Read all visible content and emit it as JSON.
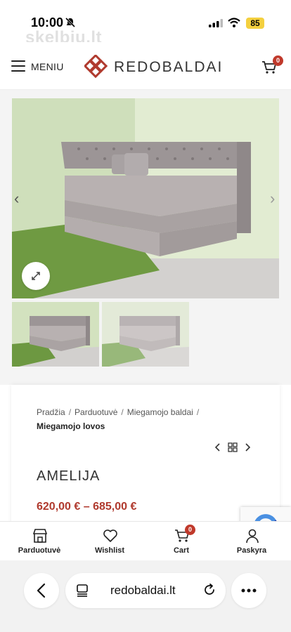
{
  "status_bar": {
    "time": "10:00",
    "battery": "85",
    "watermark": "skelbiu.lt"
  },
  "header": {
    "menu_label": "MENIU",
    "logo_text": "REDOBALDAI",
    "cart_count": "0"
  },
  "gallery": {
    "prev_arrow": "‹",
    "next_arrow": "›"
  },
  "breadcrumb": {
    "items": [
      "Pradžia",
      "Parduotuvė",
      "Miegamojo baldai"
    ],
    "separator": "/",
    "current": "Miegamojo lovos"
  },
  "product": {
    "title": "AMELIJA",
    "price": "620,00 € – 685,00 €"
  },
  "bottom_nav": {
    "shop": "Parduotuvė",
    "wishlist": "Wishlist",
    "cart": "Cart",
    "cart_count": "0",
    "account": "Paskyra"
  },
  "browser": {
    "url": "redobaldai.lt"
  },
  "colors": {
    "accent": "#b03a2e",
    "badge": "#c0392b",
    "battery": "#f4d03f"
  }
}
